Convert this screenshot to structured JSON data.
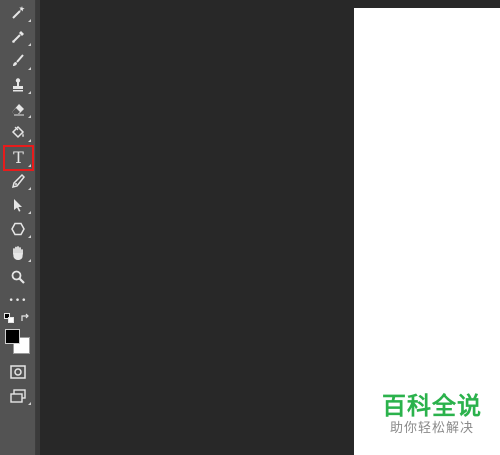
{
  "toolbar": {
    "tools": [
      {
        "name": "magic-wand-icon"
      },
      {
        "name": "eyedropper-icon"
      },
      {
        "name": "brush-icon"
      },
      {
        "name": "clone-stamp-icon"
      },
      {
        "name": "eraser-icon"
      },
      {
        "name": "paint-bucket-icon"
      },
      {
        "name": "type-tool-icon",
        "glyph": "T",
        "selected": true
      },
      {
        "name": "pen-icon"
      },
      {
        "name": "path-selection-icon"
      },
      {
        "name": "shape-icon"
      },
      {
        "name": "hand-icon"
      },
      {
        "name": "zoom-icon"
      },
      {
        "name": "more-tools-icon",
        "glyph": "•••"
      }
    ],
    "colors": {
      "foreground": "#000000",
      "background": "#ffffff",
      "selection_outline": "#e81c1c"
    }
  },
  "watermark": {
    "title": "百科全说",
    "subtitle": "助你轻松解决",
    "title_color": "#2bb24c"
  }
}
